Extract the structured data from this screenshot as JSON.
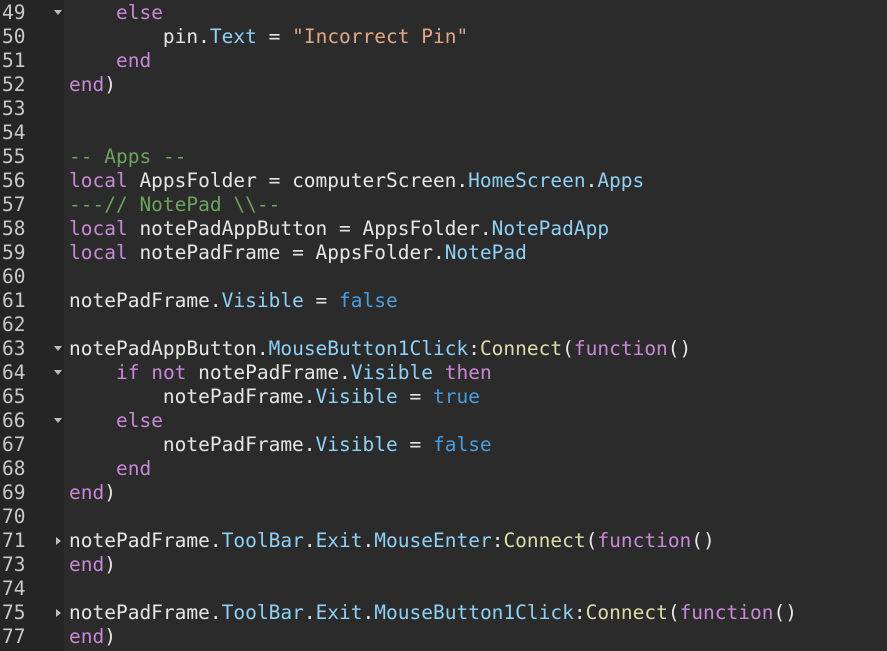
{
  "colors": {
    "background": "#2b2b2b",
    "gutter": "#252526",
    "line_number": "#c8c8c8",
    "plain": "#e6e6e6",
    "keyword": "#c888d8",
    "builtin": "#dcdcaa",
    "string": "#e0a883",
    "comment": "#6ca35e",
    "property": "#8fd0f5",
    "literal": "#4a9ee0"
  },
  "lines": [
    {
      "num": "49",
      "fold": "expanded",
      "tokens": [
        {
          "t": "    "
        },
        {
          "t": "else",
          "c": "kw"
        }
      ]
    },
    {
      "num": "50",
      "fold": "",
      "tokens": [
        {
          "t": "        pin."
        },
        {
          "t": "Text",
          "c": "prop"
        },
        {
          "t": " = "
        },
        {
          "t": "\"Incorrect Pin\"",
          "c": "str"
        }
      ]
    },
    {
      "num": "51",
      "fold": "",
      "tokens": [
        {
          "t": "    "
        },
        {
          "t": "end",
          "c": "kw"
        }
      ]
    },
    {
      "num": "52",
      "fold": "",
      "tokens": [
        {
          "t": "end",
          "c": "kw"
        },
        {
          "t": ")"
        }
      ]
    },
    {
      "num": "53",
      "fold": "",
      "tokens": []
    },
    {
      "num": "54",
      "fold": "",
      "tokens": []
    },
    {
      "num": "55",
      "fold": "",
      "tokens": [
        {
          "t": "-- Apps --",
          "c": "cm"
        }
      ]
    },
    {
      "num": "56",
      "fold": "",
      "tokens": [
        {
          "t": "local",
          "c": "kw"
        },
        {
          "t": " AppsFolder = computerScreen."
        },
        {
          "t": "HomeScreen",
          "c": "prop"
        },
        {
          "t": "."
        },
        {
          "t": "Apps",
          "c": "prop"
        }
      ]
    },
    {
      "num": "57",
      "fold": "",
      "tokens": [
        {
          "t": "---// NotePad \\\\--",
          "c": "cm"
        }
      ]
    },
    {
      "num": "58",
      "fold": "",
      "tokens": [
        {
          "t": "local",
          "c": "kw"
        },
        {
          "t": " notePadAppButton = AppsFolder."
        },
        {
          "t": "NotePadApp",
          "c": "prop"
        }
      ]
    },
    {
      "num": "59",
      "fold": "",
      "tokens": [
        {
          "t": "local",
          "c": "kw"
        },
        {
          "t": " notePadFrame = AppsFolder."
        },
        {
          "t": "NotePad",
          "c": "prop"
        }
      ]
    },
    {
      "num": "60",
      "fold": "",
      "tokens": []
    },
    {
      "num": "61",
      "fold": "",
      "tokens": [
        {
          "t": "notePadFrame."
        },
        {
          "t": "Visible",
          "c": "prop"
        },
        {
          "t": " = "
        },
        {
          "t": "false",
          "c": "lit"
        }
      ]
    },
    {
      "num": "62",
      "fold": "",
      "tokens": []
    },
    {
      "num": "63",
      "fold": "expanded",
      "tokens": [
        {
          "t": "notePadAppButton."
        },
        {
          "t": "MouseButton1Click",
          "c": "prop"
        },
        {
          "t": ":"
        },
        {
          "t": "Connect",
          "c": "bi"
        },
        {
          "t": "("
        },
        {
          "t": "function",
          "c": "kw"
        },
        {
          "t": "()"
        }
      ]
    },
    {
      "num": "64",
      "fold": "expanded",
      "tokens": [
        {
          "t": "    "
        },
        {
          "t": "if",
          "c": "kw"
        },
        {
          "t": " "
        },
        {
          "t": "not",
          "c": "kw"
        },
        {
          "t": " notePadFrame."
        },
        {
          "t": "Visible",
          "c": "prop"
        },
        {
          "t": " "
        },
        {
          "t": "then",
          "c": "kw"
        }
      ]
    },
    {
      "num": "65",
      "fold": "",
      "tokens": [
        {
          "t": "        notePadFrame."
        },
        {
          "t": "Visible",
          "c": "prop"
        },
        {
          "t": " = "
        },
        {
          "t": "true",
          "c": "lit"
        }
      ]
    },
    {
      "num": "66",
      "fold": "expanded",
      "tokens": [
        {
          "t": "    "
        },
        {
          "t": "else",
          "c": "kw"
        }
      ]
    },
    {
      "num": "67",
      "fold": "",
      "tokens": [
        {
          "t": "        notePadFrame."
        },
        {
          "t": "Visible",
          "c": "prop"
        },
        {
          "t": " = "
        },
        {
          "t": "false",
          "c": "lit"
        }
      ]
    },
    {
      "num": "68",
      "fold": "",
      "tokens": [
        {
          "t": "    "
        },
        {
          "t": "end",
          "c": "kw"
        }
      ]
    },
    {
      "num": "69",
      "fold": "",
      "tokens": [
        {
          "t": "end",
          "c": "kw"
        },
        {
          "t": ")"
        }
      ]
    },
    {
      "num": "70",
      "fold": "",
      "tokens": []
    },
    {
      "num": "71",
      "fold": "collapsed",
      "tokens": [
        {
          "t": "notePadFrame."
        },
        {
          "t": "ToolBar",
          "c": "prop"
        },
        {
          "t": "."
        },
        {
          "t": "Exit",
          "c": "prop"
        },
        {
          "t": "."
        },
        {
          "t": "MouseEnter",
          "c": "prop"
        },
        {
          "t": ":"
        },
        {
          "t": "Connect",
          "c": "bi"
        },
        {
          "t": "("
        },
        {
          "t": "function",
          "c": "kw"
        },
        {
          "t": "()"
        }
      ]
    },
    {
      "num": "73",
      "fold": "",
      "tokens": [
        {
          "t": "end",
          "c": "kw"
        },
        {
          "t": ")"
        }
      ]
    },
    {
      "num": "74",
      "fold": "",
      "tokens": []
    },
    {
      "num": "75",
      "fold": "collapsed",
      "tokens": [
        {
          "t": "notePadFrame."
        },
        {
          "t": "ToolBar",
          "c": "prop"
        },
        {
          "t": "."
        },
        {
          "t": "Exit",
          "c": "prop"
        },
        {
          "t": "."
        },
        {
          "t": "MouseButton1Click",
          "c": "prop"
        },
        {
          "t": ":"
        },
        {
          "t": "Connect",
          "c": "bi"
        },
        {
          "t": "("
        },
        {
          "t": "function",
          "c": "kw"
        },
        {
          "t": "()"
        }
      ]
    },
    {
      "num": "77",
      "fold": "",
      "tokens": [
        {
          "t": "end",
          "c": "kw"
        },
        {
          "t": ")"
        }
      ]
    }
  ]
}
